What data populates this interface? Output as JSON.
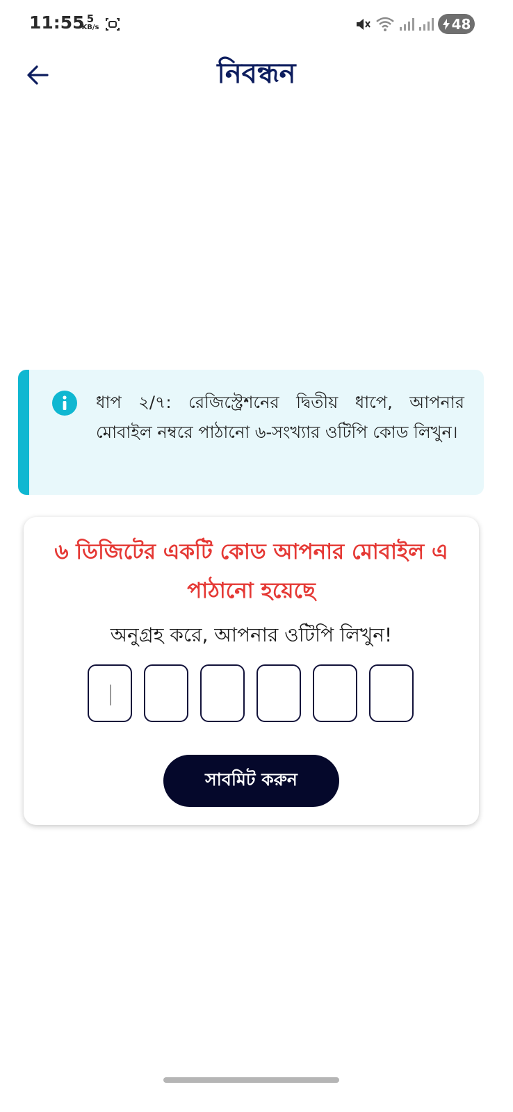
{
  "status_bar": {
    "time": "11:55",
    "net_speed_value": "5",
    "net_speed_unit": "KB/s",
    "battery_level": "48",
    "icons": [
      "screen-record-icon",
      "mute-icon",
      "wifi-icon",
      "signal-icon",
      "signal-icon",
      "charging-icon"
    ]
  },
  "header": {
    "title": "নিবন্ধন",
    "back_icon": "arrow-left-icon"
  },
  "info_notice": {
    "icon": "info-icon",
    "text": "ধাপ ২/৭: রেজিস্ট্রেশনের দ্বিতীয় ধাপে, আপনার মোবাইল নম্বরে পাঠানো ৬-সংখ্যার ওটিপি কোড লিখুন।"
  },
  "otp_card": {
    "heading": "৬ ডিজিটের একটি কোড আপনার মোবাইল এ পাঠানো হয়েছে",
    "instruction": "অনুগ্রহ করে, আপনার ওটিপি লিখুন!",
    "digits": [
      "",
      "",
      "",
      "",
      "",
      ""
    ],
    "submit_label": "সাবমিট করুন"
  },
  "colors": {
    "primary_dark": "#05082b",
    "title_blue": "#0d1d5e",
    "alert_red": "#e53935",
    "info_accent": "#0fb7d1",
    "info_bg": "#e8f8fb"
  }
}
